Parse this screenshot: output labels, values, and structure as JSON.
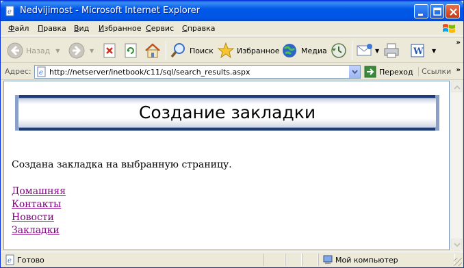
{
  "window": {
    "title": "Nedvijimost - Microsoft Internet Explorer"
  },
  "menu": [
    {
      "label": "Файл",
      "key": "Ф",
      "rest": "айл"
    },
    {
      "label": "Правка",
      "key": "П",
      "rest": "равка"
    },
    {
      "label": "Вид",
      "key": "В",
      "rest": "ид"
    },
    {
      "label": "Избранное",
      "key": "И",
      "rest": "збранное"
    },
    {
      "label": "Сервис",
      "key": "С",
      "rest": "ервис"
    },
    {
      "label": "Справка",
      "key": "С",
      "rest": "правка"
    }
  ],
  "toolbar": {
    "back_label": "Назад",
    "search_label": "Поиск",
    "favorites_label": "Избранное",
    "media_label": "Медиа"
  },
  "address": {
    "label": "Адрес:",
    "url": "http://netserver/inetbook/c11/sql/search_results.aspx",
    "go_label": "Переход",
    "links_label": "Ссылки"
  },
  "page": {
    "banner_title": "Создание закладки",
    "message": "Создана закладка на выбранную страницу.",
    "links": [
      "Домашняя",
      "Контакты",
      "Новости",
      "Закладки"
    ]
  },
  "status": {
    "text": "Готово",
    "zone": "Мой компьютер"
  },
  "colors": {
    "titlebar": "#0055e5",
    "visited_link": "#800080",
    "banner_frame": "#1f3c78"
  }
}
